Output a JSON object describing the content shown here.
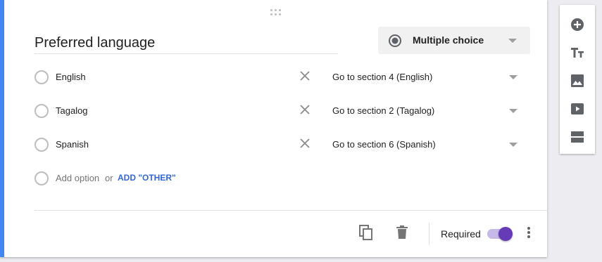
{
  "question": {
    "title": "Preferred language",
    "type_label": "Multiple choice",
    "type_icon": "radio-button-icon",
    "options": [
      {
        "label": "English",
        "goto": "Go to section 4 (English)"
      },
      {
        "label": "Tagalog",
        "goto": "Go to section 2 (Tagalog)"
      },
      {
        "label": "Spanish",
        "goto": "Go to section 6 (Spanish)"
      }
    ],
    "add_option": {
      "label": "Add option",
      "or": "or",
      "other": "ADD \"OTHER\""
    }
  },
  "footer": {
    "required_label": "Required",
    "required_on": true,
    "icons": [
      "copy-icon",
      "delete-icon",
      "more-vert-icon"
    ]
  },
  "toolbar": {
    "icons": [
      "add-circle-icon",
      "title-icon",
      "image-icon",
      "video-icon",
      "section-icon"
    ]
  },
  "colors": {
    "accent": "#673ab7",
    "active_border": "#4285f4",
    "link": "#3367d6"
  }
}
